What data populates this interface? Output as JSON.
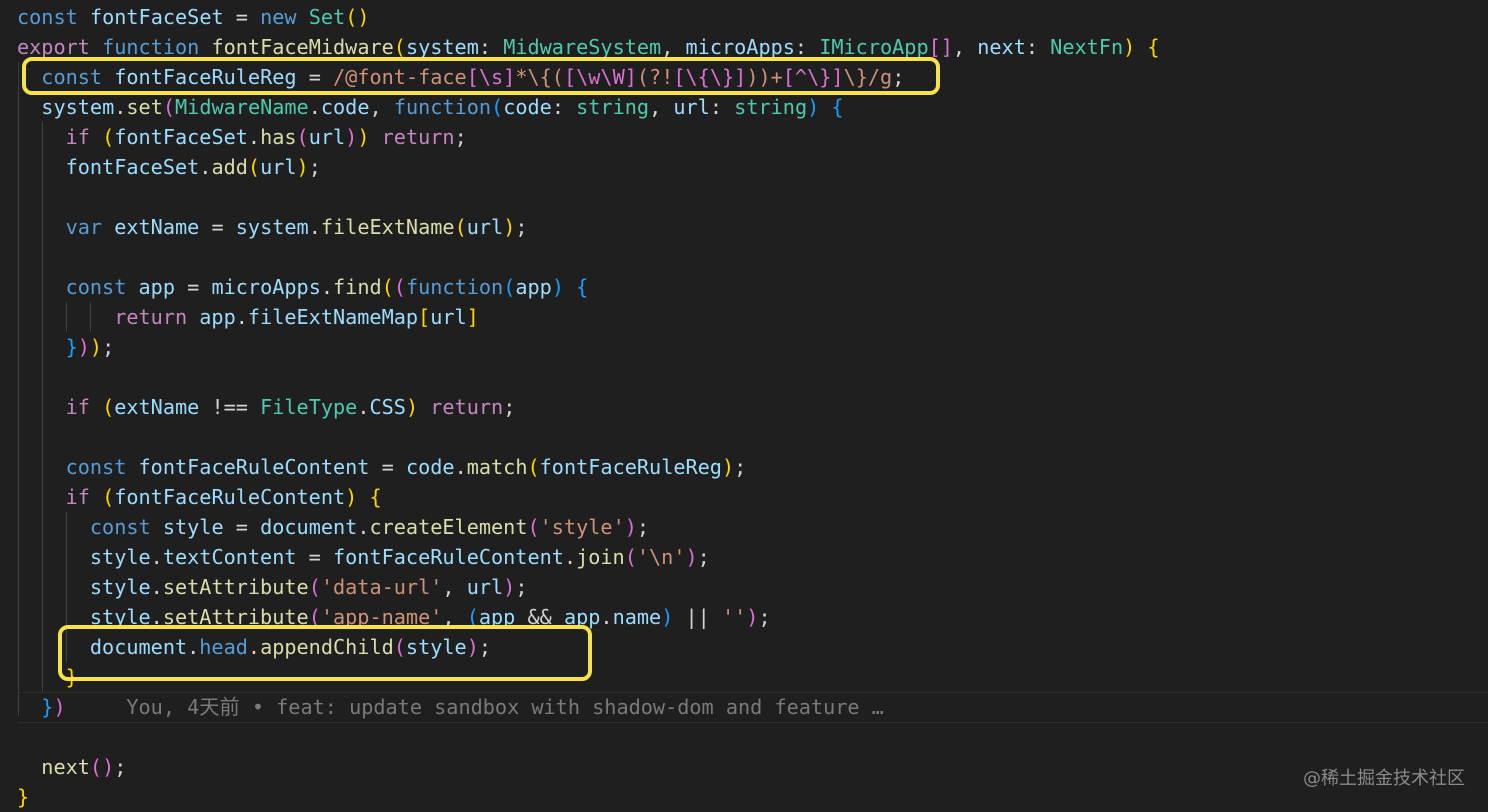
{
  "colors": {
    "background": "#1f1f1f",
    "keyword": "#569cd6",
    "control": "#c586c0",
    "function": "#dcdcaa",
    "variable": "#9cdcfe",
    "type": "#4ec9b0",
    "string": "#ce9178",
    "plain": "#d4d4d4",
    "bracket_gold": "#ffd700",
    "bracket_purple": "#da70d6",
    "bracket_blue": "#179fff",
    "blame": "#7a7a7a",
    "highlight": "#f7e24b"
  },
  "code_lines": [
    {
      "indent": 0,
      "tokens": [
        [
          "const ",
          "keyword"
        ],
        [
          "fontFaceSet",
          "variable"
        ],
        [
          " = ",
          "plain"
        ],
        [
          "new ",
          "keyword"
        ],
        [
          "Set",
          "type"
        ],
        [
          "()",
          "bracket_gold"
        ]
      ]
    },
    {
      "indent": 0,
      "tokens": [
        [
          "export ",
          "control"
        ],
        [
          "function ",
          "keyword"
        ],
        [
          "fontFaceMidware",
          "function"
        ],
        [
          "(",
          "bracket_gold"
        ],
        [
          "system",
          "variable"
        ],
        [
          ": ",
          "plain"
        ],
        [
          "MidwareSystem",
          "type"
        ],
        [
          ", ",
          "plain"
        ],
        [
          "microApps",
          "variable"
        ],
        [
          ": ",
          "plain"
        ],
        [
          "IMicroApp",
          "type"
        ],
        [
          "[]",
          "bracket_purple"
        ],
        [
          ", ",
          "plain"
        ],
        [
          "next",
          "variable"
        ],
        [
          ": ",
          "plain"
        ],
        [
          "NextFn",
          "type"
        ],
        [
          ") ",
          "bracket_gold"
        ],
        [
          "{",
          "bracket_gold"
        ]
      ]
    },
    {
      "indent": 1,
      "tokens": [
        [
          "const ",
          "keyword"
        ],
        [
          "fontFaceRuleReg",
          "variable"
        ],
        [
          " = ",
          "plain"
        ],
        [
          "/@font-face",
          "string"
        ],
        [
          "[\\s]",
          "bracket_purple"
        ],
        [
          "*\\{(",
          "string"
        ],
        [
          "[\\w\\W]",
          "bracket_purple"
        ],
        [
          "(?!",
          "string"
        ],
        [
          "[\\{\\}]",
          "bracket_purple"
        ],
        [
          "))+",
          "string"
        ],
        [
          "[^\\}]",
          "bracket_purple"
        ],
        [
          "\\}/g",
          "string"
        ],
        [
          ";",
          "plain"
        ]
      ]
    },
    {
      "indent": 1,
      "tokens": [
        [
          "system",
          "variable"
        ],
        [
          ".",
          "plain"
        ],
        [
          "set",
          "function"
        ],
        [
          "(",
          "bracket_purple"
        ],
        [
          "MidwareName",
          "type"
        ],
        [
          ".",
          "plain"
        ],
        [
          "code",
          "variable"
        ],
        [
          ", ",
          "plain"
        ],
        [
          "function",
          "keyword"
        ],
        [
          "(",
          "bracket_blue"
        ],
        [
          "code",
          "variable"
        ],
        [
          ": ",
          "plain"
        ],
        [
          "string",
          "type"
        ],
        [
          ", ",
          "plain"
        ],
        [
          "url",
          "variable"
        ],
        [
          ": ",
          "plain"
        ],
        [
          "string",
          "type"
        ],
        [
          ") ",
          "bracket_blue"
        ],
        [
          "{",
          "bracket_blue"
        ]
      ]
    },
    {
      "indent": 2,
      "tokens": [
        [
          "if ",
          "control"
        ],
        [
          "(",
          "bracket_gold"
        ],
        [
          "fontFaceSet",
          "variable"
        ],
        [
          ".",
          "plain"
        ],
        [
          "has",
          "function"
        ],
        [
          "(",
          "bracket_purple"
        ],
        [
          "url",
          "variable"
        ],
        [
          ")",
          "bracket_purple"
        ],
        [
          ") ",
          "bracket_gold"
        ],
        [
          "return",
          "control"
        ],
        [
          ";",
          "plain"
        ]
      ]
    },
    {
      "indent": 2,
      "tokens": [
        [
          "fontFaceSet",
          "variable"
        ],
        [
          ".",
          "plain"
        ],
        [
          "add",
          "function"
        ],
        [
          "(",
          "bracket_gold"
        ],
        [
          "url",
          "variable"
        ],
        [
          ")",
          "bracket_gold"
        ],
        [
          ";",
          "plain"
        ]
      ]
    },
    {
      "indent": 2,
      "tokens": []
    },
    {
      "indent": 2,
      "tokens": [
        [
          "var ",
          "keyword"
        ],
        [
          "extName",
          "variable"
        ],
        [
          " = ",
          "plain"
        ],
        [
          "system",
          "variable"
        ],
        [
          ".",
          "plain"
        ],
        [
          "fileExtName",
          "function"
        ],
        [
          "(",
          "bracket_gold"
        ],
        [
          "url",
          "variable"
        ],
        [
          ")",
          "bracket_gold"
        ],
        [
          ";",
          "plain"
        ]
      ]
    },
    {
      "indent": 2,
      "tokens": []
    },
    {
      "indent": 2,
      "tokens": [
        [
          "const ",
          "keyword"
        ],
        [
          "app",
          "variable"
        ],
        [
          " = ",
          "plain"
        ],
        [
          "microApps",
          "variable"
        ],
        [
          ".",
          "plain"
        ],
        [
          "find",
          "function"
        ],
        [
          "(",
          "bracket_gold"
        ],
        [
          "(",
          "bracket_purple"
        ],
        [
          "function",
          "keyword"
        ],
        [
          "(",
          "bracket_blue"
        ],
        [
          "app",
          "variable"
        ],
        [
          ") ",
          "bracket_blue"
        ],
        [
          "{",
          "bracket_blue"
        ]
      ]
    },
    {
      "indent": 4,
      "tokens": [
        [
          "return ",
          "control"
        ],
        [
          "app",
          "variable"
        ],
        [
          ".",
          "plain"
        ],
        [
          "fileExtNameMap",
          "variable"
        ],
        [
          "[",
          "bracket_gold"
        ],
        [
          "url",
          "variable"
        ],
        [
          "]",
          "bracket_gold"
        ]
      ]
    },
    {
      "indent": 2,
      "tokens": [
        [
          "}",
          "bracket_blue"
        ],
        [
          ")",
          "bracket_purple"
        ],
        [
          ")",
          "bracket_gold"
        ],
        [
          ";",
          "plain"
        ]
      ]
    },
    {
      "indent": 2,
      "tokens": []
    },
    {
      "indent": 2,
      "tokens": [
        [
          "if ",
          "control"
        ],
        [
          "(",
          "bracket_gold"
        ],
        [
          "extName",
          "variable"
        ],
        [
          " !== ",
          "plain"
        ],
        [
          "FileType",
          "type"
        ],
        [
          ".",
          "plain"
        ],
        [
          "CSS",
          "variable"
        ],
        [
          ") ",
          "bracket_gold"
        ],
        [
          "return",
          "control"
        ],
        [
          ";",
          "plain"
        ]
      ]
    },
    {
      "indent": 2,
      "tokens": []
    },
    {
      "indent": 2,
      "tokens": [
        [
          "const ",
          "keyword"
        ],
        [
          "fontFaceRuleContent",
          "variable"
        ],
        [
          " = ",
          "plain"
        ],
        [
          "code",
          "variable"
        ],
        [
          ".",
          "plain"
        ],
        [
          "match",
          "function"
        ],
        [
          "(",
          "bracket_gold"
        ],
        [
          "fontFaceRuleReg",
          "variable"
        ],
        [
          ")",
          "bracket_gold"
        ],
        [
          ";",
          "plain"
        ]
      ]
    },
    {
      "indent": 2,
      "tokens": [
        [
          "if ",
          "control"
        ],
        [
          "(",
          "bracket_gold"
        ],
        [
          "fontFaceRuleContent",
          "variable"
        ],
        [
          ") ",
          "bracket_gold"
        ],
        [
          "{",
          "bracket_gold"
        ]
      ]
    },
    {
      "indent": 3,
      "tokens": [
        [
          "const ",
          "keyword"
        ],
        [
          "style",
          "variable"
        ],
        [
          " = ",
          "plain"
        ],
        [
          "document",
          "variable"
        ],
        [
          ".",
          "plain"
        ],
        [
          "createElement",
          "function"
        ],
        [
          "(",
          "bracket_purple"
        ],
        [
          "'style'",
          "string"
        ],
        [
          ")",
          "bracket_purple"
        ],
        [
          ";",
          "plain"
        ]
      ]
    },
    {
      "indent": 3,
      "tokens": [
        [
          "style",
          "variable"
        ],
        [
          ".",
          "plain"
        ],
        [
          "textContent",
          "variable"
        ],
        [
          " = ",
          "plain"
        ],
        [
          "fontFaceRuleContent",
          "variable"
        ],
        [
          ".",
          "plain"
        ],
        [
          "join",
          "function"
        ],
        [
          "(",
          "bracket_purple"
        ],
        [
          "'\\n'",
          "string"
        ],
        [
          ")",
          "bracket_purple"
        ],
        [
          ";",
          "plain"
        ]
      ]
    },
    {
      "indent": 3,
      "tokens": [
        [
          "style",
          "variable"
        ],
        [
          ".",
          "plain"
        ],
        [
          "setAttribute",
          "function"
        ],
        [
          "(",
          "bracket_purple"
        ],
        [
          "'data-url'",
          "string"
        ],
        [
          ", ",
          "plain"
        ],
        [
          "url",
          "variable"
        ],
        [
          ")",
          "bracket_purple"
        ],
        [
          ";",
          "plain"
        ]
      ]
    },
    {
      "indent": 3,
      "tokens": [
        [
          "style",
          "variable"
        ],
        [
          ".",
          "plain"
        ],
        [
          "setAttribute",
          "function"
        ],
        [
          "(",
          "bracket_purple"
        ],
        [
          "'app-name'",
          "string"
        ],
        [
          ", ",
          "plain"
        ],
        [
          "(",
          "bracket_blue"
        ],
        [
          "app ",
          "variable"
        ],
        [
          "&& ",
          "plain"
        ],
        [
          "app",
          "variable"
        ],
        [
          ".",
          "plain"
        ],
        [
          "name",
          "variable"
        ],
        [
          ") ",
          "bracket_blue"
        ],
        [
          "|| ",
          "plain"
        ],
        [
          "''",
          "string"
        ],
        [
          ")",
          "bracket_purple"
        ],
        [
          ";",
          "plain"
        ]
      ]
    },
    {
      "indent": 3,
      "tokens": [
        [
          "document",
          "variable"
        ],
        [
          ".",
          "plain"
        ],
        [
          "head",
          "keyword"
        ],
        [
          ".",
          "plain"
        ],
        [
          "appendChild",
          "function"
        ],
        [
          "(",
          "bracket_purple"
        ],
        [
          "style",
          "variable"
        ],
        [
          ")",
          "bracket_purple"
        ],
        [
          ";",
          "plain"
        ]
      ]
    },
    {
      "indent": 2,
      "tokens": [
        [
          "}",
          "bracket_gold"
        ]
      ]
    },
    {
      "indent": 1,
      "tokens": [
        [
          "}",
          "bracket_blue"
        ],
        [
          ")",
          "bracket_purple"
        ]
      ],
      "blame": "You, 4天前 • feat: update sandbox with shadow-dom and feature …"
    },
    {
      "indent": 1,
      "tokens": []
    },
    {
      "indent": 1,
      "tokens": [
        [
          "next",
          "function"
        ],
        [
          "()",
          "bracket_purple"
        ],
        [
          ";",
          "plain"
        ]
      ]
    },
    {
      "indent": 0,
      "tokens": [
        [
          "}",
          "bracket_gold"
        ]
      ]
    }
  ],
  "watermark": "@稀土掘金技术社区"
}
